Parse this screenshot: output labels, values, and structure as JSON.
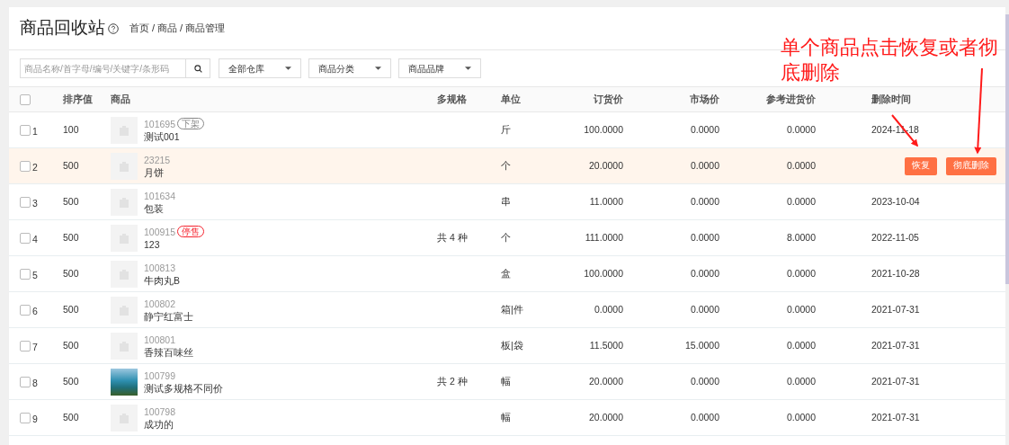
{
  "page_title": "商品回收站",
  "breadcrumb": {
    "items": [
      "首页",
      "商品",
      "商品管理"
    ],
    "separator": "/"
  },
  "filters": {
    "search_placeholder": "商品名称/首字母/编号/关键字/条形码",
    "dropdowns": [
      "全部仓库",
      "商品分类",
      "商品品牌"
    ]
  },
  "table": {
    "select_all_checked": false,
    "columns": [
      "排序值",
      "商品",
      "多规格",
      "单位",
      "订货价",
      "市场价",
      "参考进货价",
      "删除时间"
    ],
    "rows": [
      {
        "index": "1",
        "checked": false,
        "highlighted": false,
        "sort": "100",
        "kind": "placeholder",
        "code": "101695",
        "tag": {
          "label": "下架",
          "color": "#888888"
        },
        "name": "测试001",
        "specs": "",
        "unit": "斤",
        "order_price": "100.0000",
        "market_price": "0.0000",
        "ref_price": "0.0000",
        "deleted": "2024-11-18"
      },
      {
        "index": "2",
        "checked": false,
        "highlighted": true,
        "sort": "500",
        "kind": "placeholder",
        "code": "23215",
        "name": "月饼",
        "specs": "",
        "unit": "个",
        "order_price": "20.0000",
        "market_price": "0.0000",
        "ref_price": "0.0000",
        "actions": [
          "恢复",
          "彻底删除"
        ]
      },
      {
        "index": "3",
        "checked": false,
        "highlighted": false,
        "sort": "500",
        "kind": "placeholder",
        "code": "101634",
        "name": "包装",
        "specs": "",
        "unit": "串",
        "order_price": "11.0000",
        "market_price": "0.0000",
        "ref_price": "0.0000",
        "deleted": "2023-10-04"
      },
      {
        "index": "4",
        "checked": false,
        "highlighted": false,
        "sort": "500",
        "kind": "placeholder",
        "code": "100915",
        "tag": {
          "label": "停售",
          "color": "#f5222d"
        },
        "name": "123",
        "specs": "共 4 种",
        "unit": "个",
        "order_price": "111.0000",
        "market_price": "0.0000",
        "ref_price": "8.0000",
        "deleted": "2022-11-05"
      },
      {
        "index": "5",
        "checked": false,
        "highlighted": false,
        "sort": "500",
        "kind": "placeholder",
        "code": "100813",
        "name": "牛肉丸B",
        "specs": "",
        "unit": "盒",
        "order_price": "100.0000",
        "market_price": "0.0000",
        "ref_price": "0.0000",
        "deleted": "2021-10-28"
      },
      {
        "index": "6",
        "checked": false,
        "highlighted": false,
        "sort": "500",
        "kind": "placeholder",
        "code": "100802",
        "name": "静宁红富士",
        "specs": "",
        "unit": "箱|件",
        "order_price": "0.0000",
        "market_price": "0.0000",
        "ref_price": "0.0000",
        "deleted": "2021-07-31"
      },
      {
        "index": "7",
        "checked": false,
        "highlighted": false,
        "sort": "500",
        "kind": "placeholder",
        "code": "100801",
        "name": "香辣百味丝",
        "specs": "",
        "unit": "板|袋",
        "order_price": "11.5000",
        "market_price": "15.0000",
        "ref_price": "0.0000",
        "deleted": "2021-07-31"
      },
      {
        "index": "8",
        "checked": false,
        "highlighted": false,
        "sort": "500",
        "kind": "photo",
        "code": "100799",
        "name": "测试多规格不同价",
        "specs": "共 2 种",
        "unit": "幅",
        "order_price": "20.0000",
        "market_price": "0.0000",
        "ref_price": "0.0000",
        "deleted": "2021-07-31"
      },
      {
        "index": "9",
        "checked": false,
        "highlighted": false,
        "sort": "500",
        "kind": "placeholder",
        "code": "100798",
        "name": "成功的",
        "specs": "",
        "unit": "幅",
        "order_price": "20.0000",
        "market_price": "0.0000",
        "ref_price": "0.0000",
        "deleted": "2021-07-31"
      }
    ]
  },
  "annotation": {
    "text": "单个商品点击恢复或者彻底删除"
  }
}
